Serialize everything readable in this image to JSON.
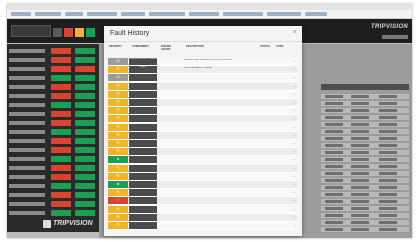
{
  "modal": {
    "title": "Fault History",
    "close_icon": "×",
    "columns": {
      "severity": "SEVERITY",
      "component": "COMPONENT",
      "engine_hours": "ENGINE HOURS",
      "description": "DESCRIPTION",
      "status": "STATUS",
      "code": "CODE"
    }
  },
  "app": {
    "logo": "TRIPVISION"
  },
  "faults": [
    {
      "severity": "gray",
      "component": "Exhaust Emission Controller",
      "hours": "",
      "description": "Indicator Flash Request From DPF Controller",
      "status": "",
      "code": ""
    },
    {
      "severity": "amber",
      "component": "Engine",
      "hours": "",
      "description": "Abnormal Rate of Change",
      "status": "",
      "code": ""
    },
    {
      "severity": "gray",
      "component": "",
      "hours": "",
      "description": "",
      "status": "",
      "code": ""
    },
    {
      "severity": "amber",
      "component": "",
      "hours": "",
      "description": "",
      "status": "",
      "code": ""
    },
    {
      "severity": "amber",
      "component": "",
      "hours": "",
      "description": "",
      "status": "",
      "code": ""
    },
    {
      "severity": "amber",
      "component": "",
      "hours": "",
      "description": "",
      "status": "",
      "code": ""
    },
    {
      "severity": "amber",
      "component": "",
      "hours": "",
      "description": "",
      "status": "",
      "code": ""
    },
    {
      "severity": "amber",
      "component": "",
      "hours": "",
      "description": "",
      "status": "",
      "code": ""
    },
    {
      "severity": "amber",
      "component": "",
      "hours": "",
      "description": "",
      "status": "",
      "code": ""
    },
    {
      "severity": "amber",
      "component": "",
      "hours": "",
      "description": "",
      "status": "",
      "code": ""
    },
    {
      "severity": "amber",
      "component": "",
      "hours": "",
      "description": "",
      "status": "",
      "code": ""
    },
    {
      "severity": "amber",
      "component": "",
      "hours": "",
      "description": "",
      "status": "",
      "code": ""
    },
    {
      "severity": "green",
      "component": "",
      "hours": "",
      "description": "",
      "status": "",
      "code": ""
    },
    {
      "severity": "amber",
      "component": "",
      "hours": "",
      "description": "",
      "status": "",
      "code": ""
    },
    {
      "severity": "amber",
      "component": "",
      "hours": "",
      "description": "",
      "status": "",
      "code": ""
    },
    {
      "severity": "green",
      "component": "",
      "hours": "",
      "description": "",
      "status": "",
      "code": ""
    },
    {
      "severity": "amber",
      "component": "",
      "hours": "",
      "description": "",
      "status": "",
      "code": ""
    },
    {
      "severity": "red",
      "component": "",
      "hours": "",
      "description": "",
      "status": "",
      "code": ""
    },
    {
      "severity": "amber",
      "component": "",
      "hours": "",
      "description": "",
      "status": "",
      "code": ""
    },
    {
      "severity": "amber",
      "component": "",
      "hours": "",
      "description": "",
      "status": "",
      "code": ""
    },
    {
      "severity": "amber",
      "component": "",
      "hours": "",
      "description": "",
      "status": "",
      "code": ""
    }
  ],
  "colors": {
    "gray": "#9b9b9b",
    "amber": "#f0b428",
    "green": "#1c9e54",
    "red": "#d9442f"
  },
  "icons": {
    "amber": "wrench-icon",
    "green": "dot-icon",
    "red": "alert-icon",
    "gray": "clock-icon"
  }
}
